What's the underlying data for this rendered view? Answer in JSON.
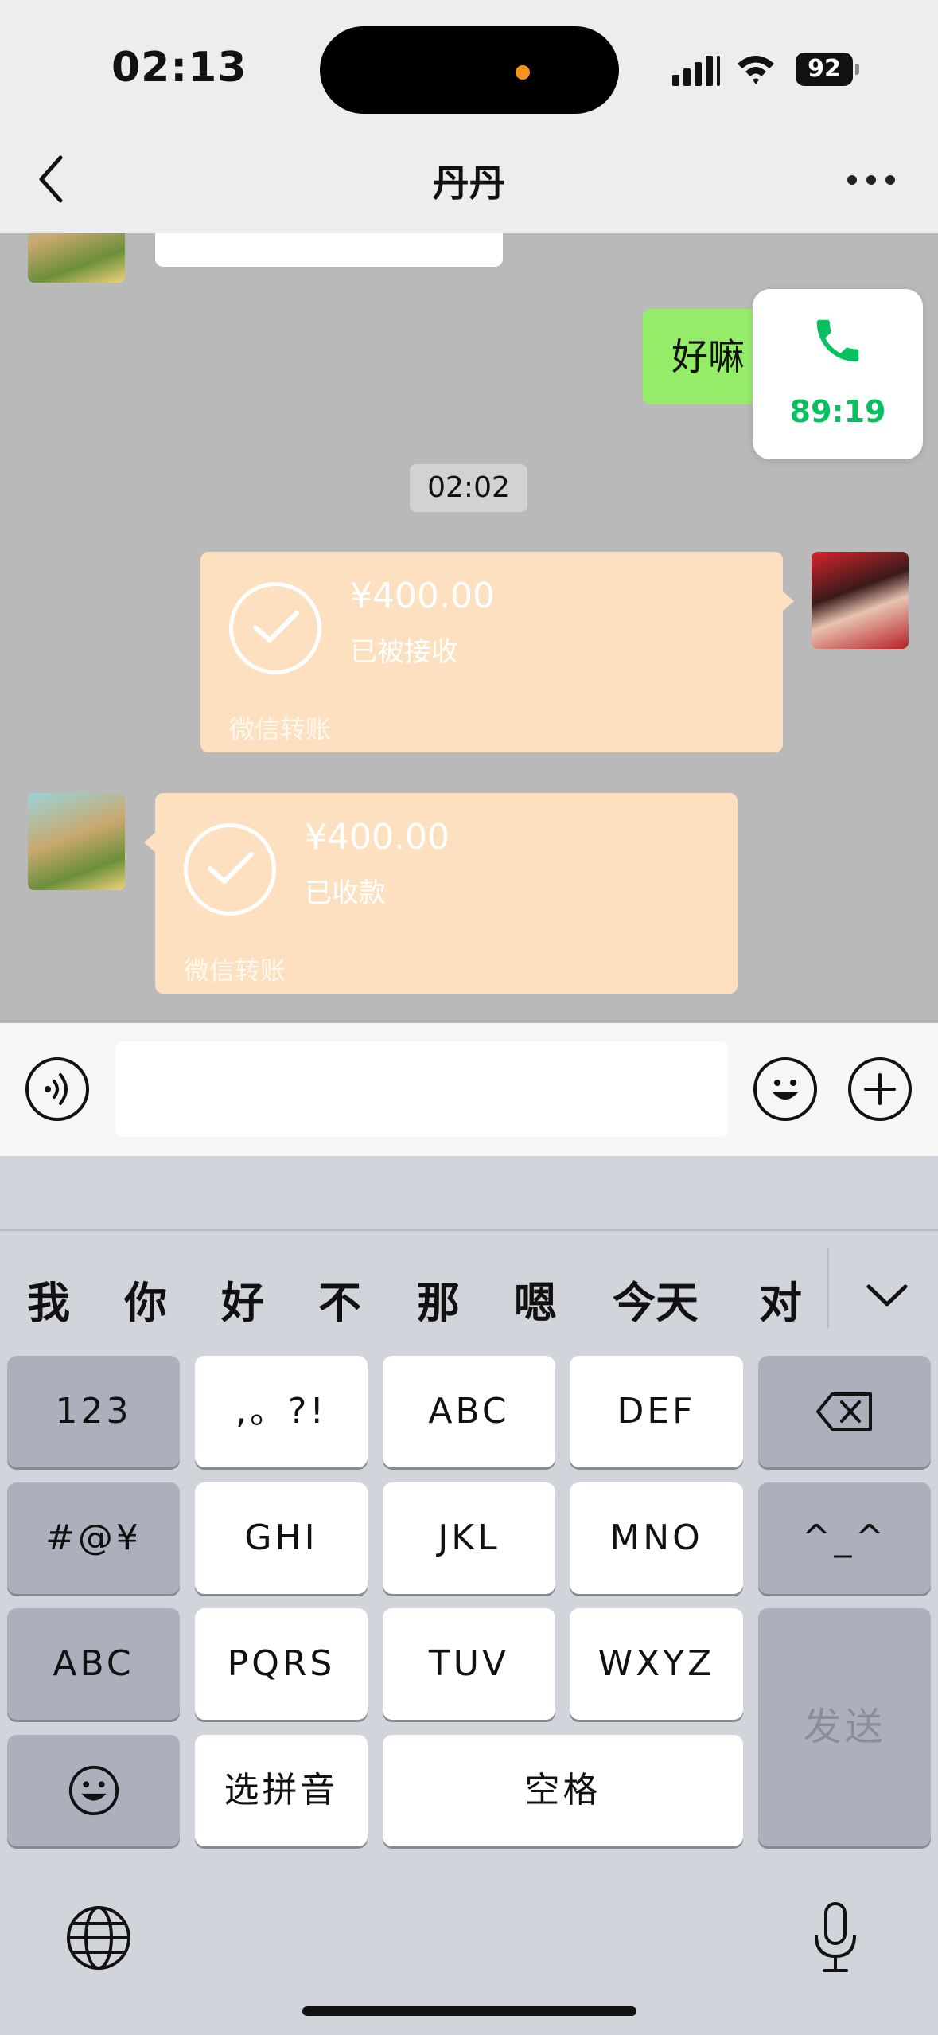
{
  "status_bar": {
    "time": "02:13",
    "battery": "92"
  },
  "nav": {
    "title": "丹丹"
  },
  "chat": {
    "partial_reply": "好嘛",
    "call_card": {
      "duration": "89:19"
    },
    "timestamp": "02:02",
    "transfer_sent": {
      "amount": "¥400.00",
      "status": "已被接收",
      "footer": "微信转账"
    },
    "transfer_received": {
      "amount": "¥400.00",
      "status": "已收款",
      "footer": "微信转账"
    }
  },
  "input_bar": {
    "text_value": ""
  },
  "keyboard": {
    "candidates": [
      "我",
      "你",
      "好",
      "不",
      "那",
      "嗯",
      "今天",
      "对"
    ],
    "keys": {
      "num": "123",
      "punct": ",。?!",
      "abc": "ABC",
      "def": "DEF",
      "sym": "#@¥",
      "ghi": "GHI",
      "jkl": "JKL",
      "mno": "MNO",
      "emoticon": "^_^",
      "abc_switch": "ABC",
      "pqrs": "PQRS",
      "tuv": "TUV",
      "wxyz": "WXYZ",
      "pinyin": "选拼音",
      "space": "空格",
      "send": "发送"
    }
  },
  "colors": {
    "accent_green": "#07c160",
    "chat_bubble_green": "#95ec69",
    "transfer_orange": "#fde0c0"
  }
}
